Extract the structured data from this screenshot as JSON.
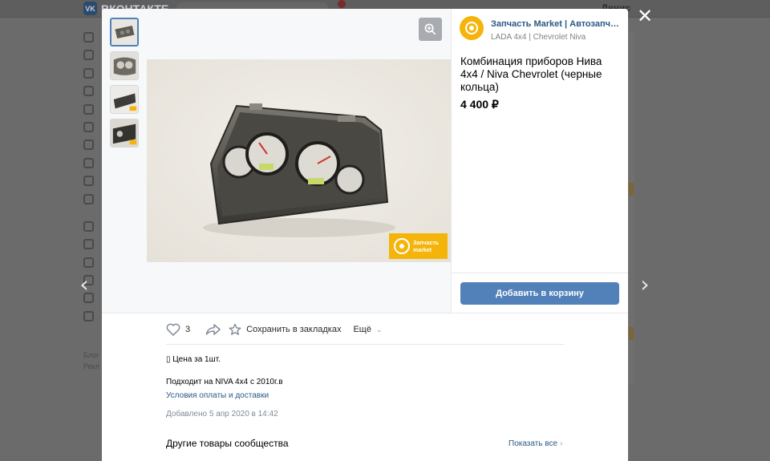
{
  "background": {
    "brand": "ВКОНТАКТЕ",
    "logo_mark": "VK",
    "profile_name": "Денис",
    "side_text": [
      "Блог",
      "Рекл"
    ]
  },
  "modal": {
    "close_icon": "close-icon",
    "prev_icon": "chevron-left-icon",
    "next_icon": "chevron-right-icon",
    "seller": {
      "name": "Запчасть Market | Автозапчасти",
      "category": "LADA 4x4 | Chevrolet Niva"
    },
    "product": {
      "title": "Комбинация приборов Нива 4x4 / Niva Chevrolet (черные кольца)",
      "price": "4 400 ₽",
      "add_to_cart": "Добавить в корзину",
      "photo_watermark_line1": "Запчасть",
      "photo_watermark_line2": "market"
    },
    "thumbnails_count": 4,
    "actions": {
      "like_count": "3",
      "save_label": "Сохранить в закладках",
      "more_label": "Ещё"
    },
    "description": {
      "line1": "▯ Цена за 1шт.",
      "line2": "Подходит на NIVA 4x4 с 2010г.в",
      "terms_link": "Условия оплаты и доставки",
      "added": "Добавлено 5 апр 2020 в 14:42"
    },
    "other": {
      "title": "Другие товары сообщества",
      "show_all": "Показать все"
    }
  },
  "colors": {
    "accent": "#5181b8",
    "link": "#2a5885",
    "brand_yellow": "#f5b40a"
  }
}
